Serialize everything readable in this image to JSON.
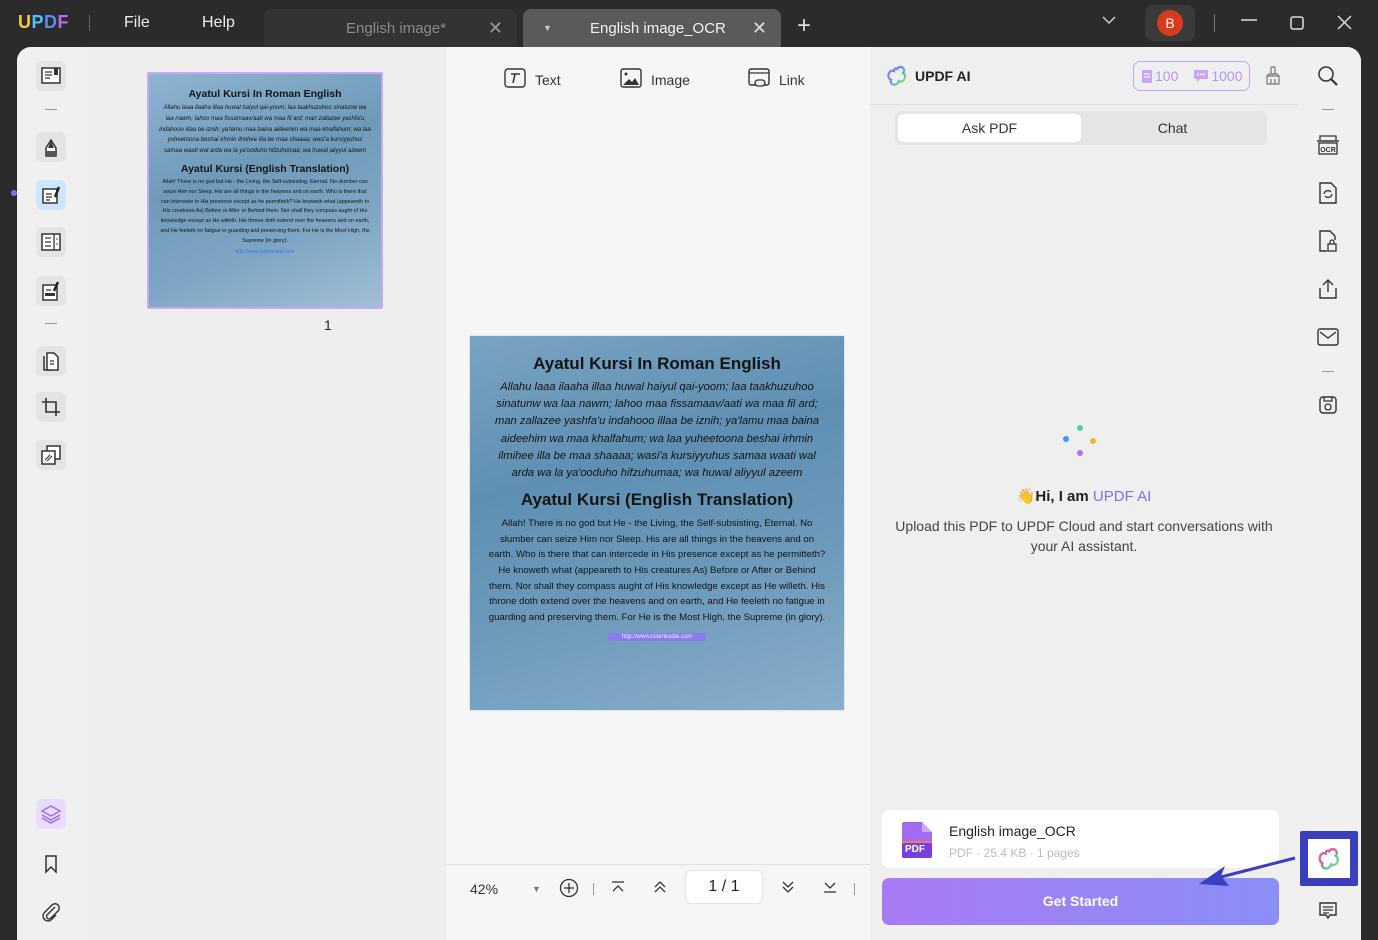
{
  "app": {
    "logo": [
      "U",
      "P",
      "D",
      "F"
    ],
    "menu": {
      "file": "File",
      "help": "Help"
    },
    "tabs": [
      {
        "label": "English image*",
        "active": false
      },
      {
        "label": "English image_OCR",
        "active": true
      }
    ],
    "user_initial": "B",
    "colors": {
      "accent": "#8a6cf0",
      "avatar": "#d63c1c",
      "highlight_box": "#3a3fbf"
    }
  },
  "left_toolbar": {
    "items": [
      "reader-icon",
      "comment-icon",
      "edit-pdf-icon",
      "form-icon",
      "fill-sign-icon",
      "organize-pages-icon",
      "crop-icon",
      "watermark-icon"
    ],
    "bottom": [
      "layers-icon",
      "bookmark-icon",
      "attachment-icon"
    ]
  },
  "thumbnails": {
    "page_number": "1"
  },
  "document": {
    "toolbar": {
      "text": "Text",
      "image": "Image",
      "link": "Link"
    },
    "content": {
      "heading1": "Ayatul Kursi In Roman English",
      "roman": "Allahu laaa ilaaha illaa huwal haiyul qai-yoom; laa taakhuzuhoo sinatunw wa laa nawm; lahoo maa fissamaav/aati wa maa fil ard; man zallazee yashfa'u indahooo illaa be iznih; ya'lamu maa baina aideehim wa maa khalfahum; wa laa yuheetoona beshai irhmin ilmihee illa be maa shaaaa; wasi'a kursiyyuhus samaa waati wal arda wa la ya'ooduho hifzuhumaa; wa huwal aliyyul azeem",
      "heading2": "Ayatul Kursi (English Translation)",
      "translation": "Allah! There is no god but He - the Living, the Self-subsisting, Eternal. No slumber can seize Him nor Sleep. His are all things in the heavens and on earth. Who is there that can intercede in His presence except as he permitteth? He knoweth what (appeareth to His creatures As) Before or After or Behind them. Nor shall they compass aught of His knowledge except as He willeth. His throne doth extend over the heavens and on earth, and He feeleth no fatigue in guarding and preserving them. For He is the Most High, the Supreme (in glory).",
      "link": "http://www.islamkadai.com"
    },
    "bottom": {
      "zoom": "42%",
      "page_display": "1 / 1"
    }
  },
  "ai_panel": {
    "title": "UPDF AI",
    "credits": {
      "pdf": "100",
      "chat": "1000"
    },
    "tabs": [
      {
        "label": "Ask PDF",
        "active": true
      },
      {
        "label": "Chat",
        "active": false
      }
    ],
    "greeting_prefix": "Hi, I am ",
    "greeting_brand": "UPDF AI",
    "wave_emoji": "👋",
    "description": "Upload this PDF to UPDF Cloud and start conversations with your AI assistant.",
    "file": {
      "name": "English image_OCR",
      "meta": "PDF · 25.4 KB · 1 pages",
      "badge": "PDF"
    },
    "button": "Get Started"
  },
  "right_toolbar": {
    "items": [
      "search-icon",
      "ocr-icon",
      "convert-icon",
      "protect-icon",
      "share-icon",
      "email-icon",
      "save-icon"
    ],
    "ocr_label": "OCR"
  }
}
